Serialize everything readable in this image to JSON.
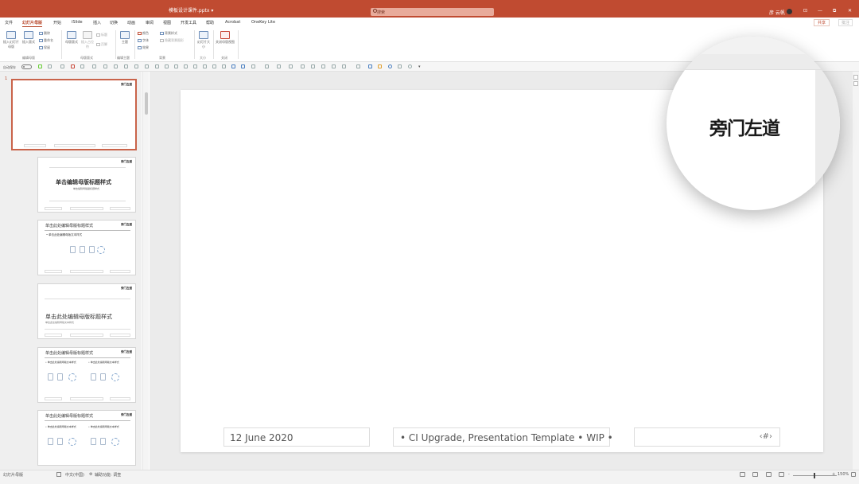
{
  "titlebar": {
    "doc_name": "模板设计课件.pptx ▾",
    "search_placeholder": "搜索",
    "user": "彦 云帆",
    "minimize": "—",
    "restore": "⧉",
    "close": "✕",
    "ribbon_opts": "⊡"
  },
  "tabs": {
    "items": [
      "文件",
      "幻灯片母版",
      "开始",
      "iSlide",
      "插入",
      "切换",
      "动画",
      "审阅",
      "视图",
      "开发工具",
      "帮助",
      "Acrobat",
      "OneKey Lite"
    ],
    "active_index": 1,
    "share": "共享",
    "comment": "批注"
  },
  "ribbon": {
    "groups": [
      "编辑母版",
      "母版版式",
      "编辑主题",
      "背景",
      "大小",
      "关闭"
    ],
    "buttons": {
      "insert_master": "插入幻灯片母版",
      "insert_layout": "插入版式",
      "delete": "删除",
      "rename": "重命名",
      "preserve": "保留",
      "master_layout": "母版版式",
      "insert_placeholder": "插入占位符",
      "title": "标题",
      "footer": "页脚",
      "theme": "主题",
      "colors": "颜色",
      "fonts": "字体",
      "effects": "效果",
      "bg_styles": "背景样式",
      "hide_bg": "隐藏背景图形",
      "slide_size": "幻灯片大小",
      "close_master": "关闭母版视图"
    }
  },
  "qat": {
    "autosave": "自动保存"
  },
  "thumbnails": {
    "first_number": "1",
    "logo": "旁门左道",
    "title_layout_title": "单击编辑母版标题样式",
    "title_layout_subtitle": "单击编辑母版副标题样式",
    "content_title": "单击此处编辑母版标题样式",
    "content_text": "• 单击此处编辑母版文本样式",
    "section_title": "单击此处编辑母版标题样式",
    "section_sub": "单击此处编辑母版文本样式"
  },
  "slide": {
    "footer_date": "12 June 2020",
    "footer_center": "• CI Upgrade, Presentation Template • WIP •",
    "footer_num": "‹#›",
    "logo": "旁门左道"
  },
  "status": {
    "view_name": "幻灯片母版",
    "language": "中文(中国)",
    "accessibility": "辅助功能: 调查",
    "zoom_out": "-",
    "zoom_in": "+",
    "zoom": "150%"
  }
}
